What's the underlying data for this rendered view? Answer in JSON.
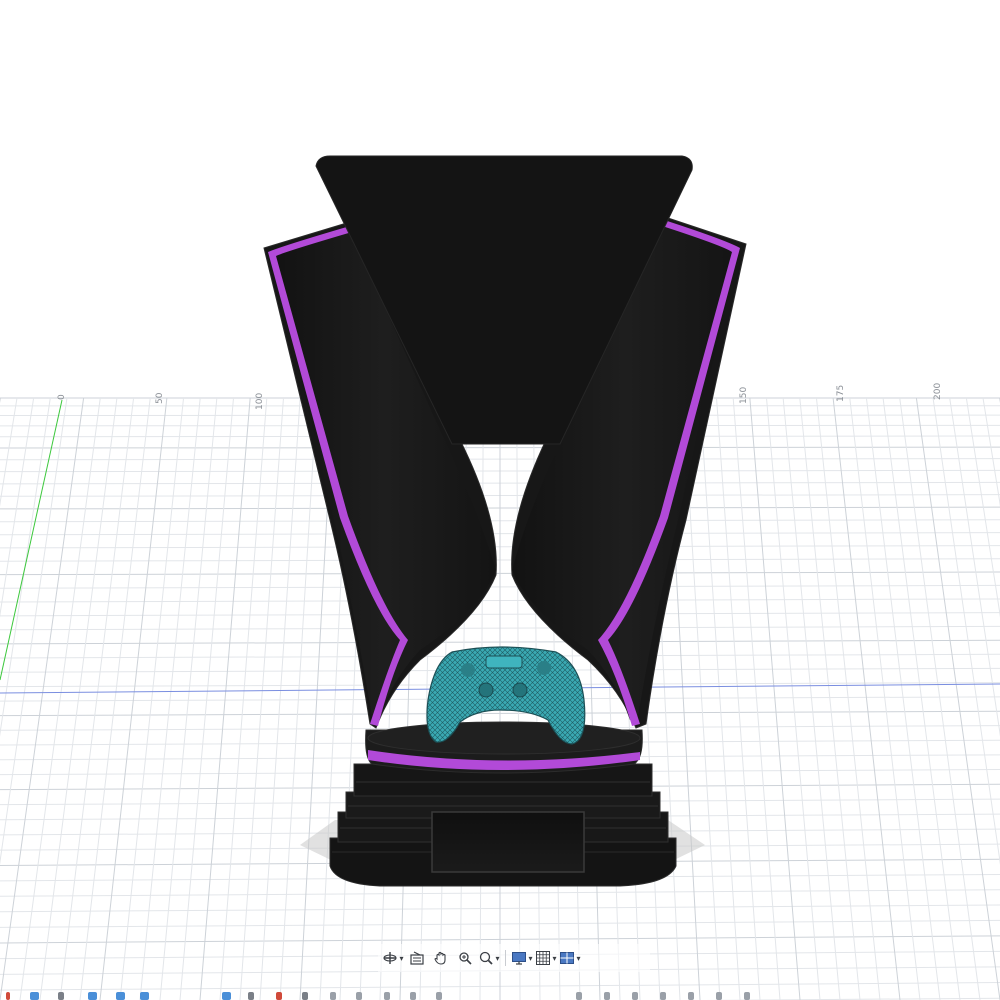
{
  "viewport": {
    "background": "#ffffff",
    "grid_color": "#e3e6ea",
    "grid_major_color": "#cdd2d8",
    "axis_green": "#3cc83c",
    "axis_blue": "#7a8ee0",
    "ruler_labels": [
      "0",
      "50",
      "100",
      "150",
      "175",
      "200"
    ]
  },
  "model": {
    "name": "trophy",
    "body_color": "#1a1a1a",
    "accent_color": "#b24ad8",
    "controller_color": "#39a8b0"
  },
  "toolbar": {
    "items": [
      {
        "name": "orbit-button",
        "icon": "orbit-icon",
        "has_menu": true
      },
      {
        "name": "look-at-button",
        "icon": "look-at-icon",
        "has_menu": false
      },
      {
        "name": "pan-button",
        "icon": "hand-icon",
        "has_menu": false
      },
      {
        "name": "zoom-window-button",
        "icon": "zoom-window-icon",
        "has_menu": false
      },
      {
        "name": "fit-button",
        "icon": "magnifier-icon",
        "has_menu": true
      },
      {
        "name": "display-settings-button",
        "icon": "monitor-icon",
        "has_menu": true
      },
      {
        "name": "grid-settings-button",
        "icon": "grid-icon",
        "has_menu": true
      },
      {
        "name": "viewports-button",
        "icon": "viewports-icon",
        "has_menu": true
      }
    ]
  }
}
